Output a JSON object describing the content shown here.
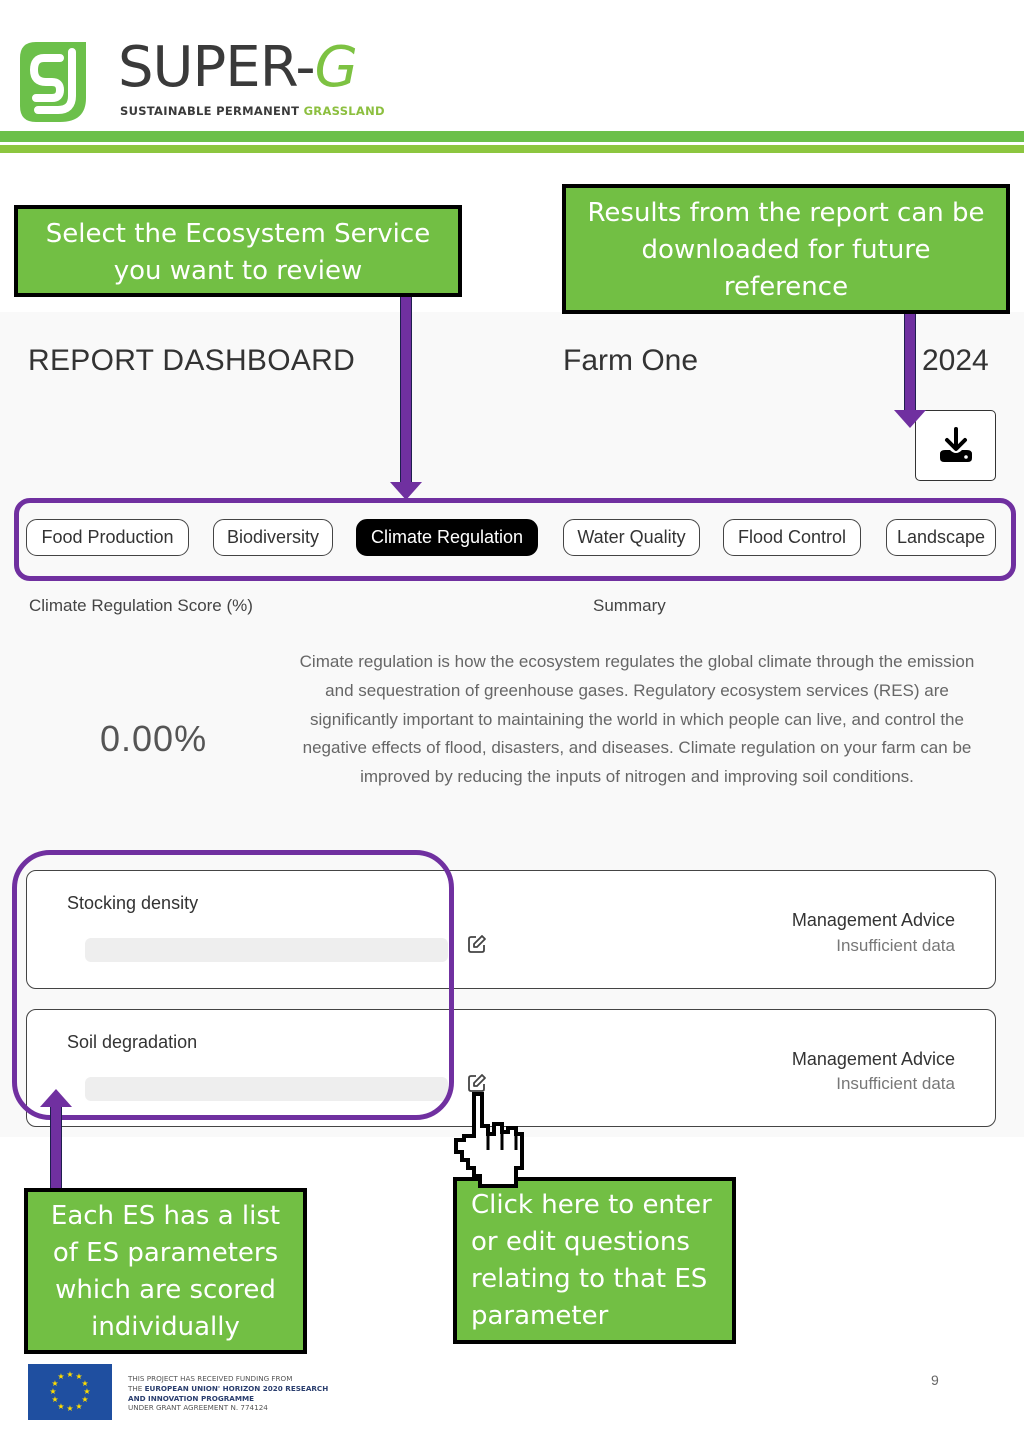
{
  "brand": {
    "name_main": "SUPER-",
    "name_accent": "G",
    "tagline_main": "SUSTAINABLE PERMANENT ",
    "tagline_accent": "GRASSLAND",
    "colors": {
      "green": "#72bf44",
      "light_green": "#8cc63f",
      "dark_text": "#3a3a3a"
    }
  },
  "annotations": {
    "select_es": "Select the Ecosystem Service you want to review",
    "download_hint": "Results from the report can be downloaded for future reference",
    "parameters_hint": "Each ES has a list of ES parameters which are scored individually",
    "edit_hint": "Click here to enter or edit questions relating to that ES parameter",
    "frame_color": "#7030a0"
  },
  "dashboard": {
    "title": "REPORT DASHBOARD",
    "farm_name": "Farm One",
    "year": "2024",
    "download_icon": "download-icon",
    "tabs": [
      {
        "label": "Food Production",
        "active": false
      },
      {
        "label": "Biodiversity",
        "active": false
      },
      {
        "label": "Climate Regulation",
        "active": true
      },
      {
        "label": "Water Quality",
        "active": false
      },
      {
        "label": "Flood Control",
        "active": false
      },
      {
        "label": "Landscape",
        "active": false
      }
    ],
    "score_label": "Climate Regulation Score (%)",
    "score_value": "0.00%",
    "summary_label": "Summary",
    "summary_text": "Cimate regulation is how the ecosystem regulates the global climate through the emission and sequestration of greenhouse gases. Regulatory ecosystem services (RES) are significantly important to maintaining the world in which people can live, and control the negative effects of flood, disasters, and diseases. Climate regulation on your farm can be improved by reducing the inputs of nitrogen and improving soil conditions.",
    "parameters": [
      {
        "name": "Stocking density",
        "advice_title": "Management Advice",
        "advice_value": "Insufficient data",
        "edit_icon": "edit-icon"
      },
      {
        "name": "Soil degradation",
        "advice_title": "Management Advice",
        "advice_value": "Insufficient data",
        "edit_icon": "edit-icon"
      }
    ]
  },
  "footer": {
    "funding_line1": "THIS PROJECT HAS RECEIVED FUNDING FROM",
    "funding_line2_prefix": "THE ",
    "funding_line2_bold": "EUROPEAN UNION' HORIZON 2020 RESEARCH",
    "funding_line3_bold": "AND INNOVATION PROGRAMME",
    "funding_line4": "UNDER GRANT AGREEMENT N. 774124",
    "page_number": "9"
  }
}
